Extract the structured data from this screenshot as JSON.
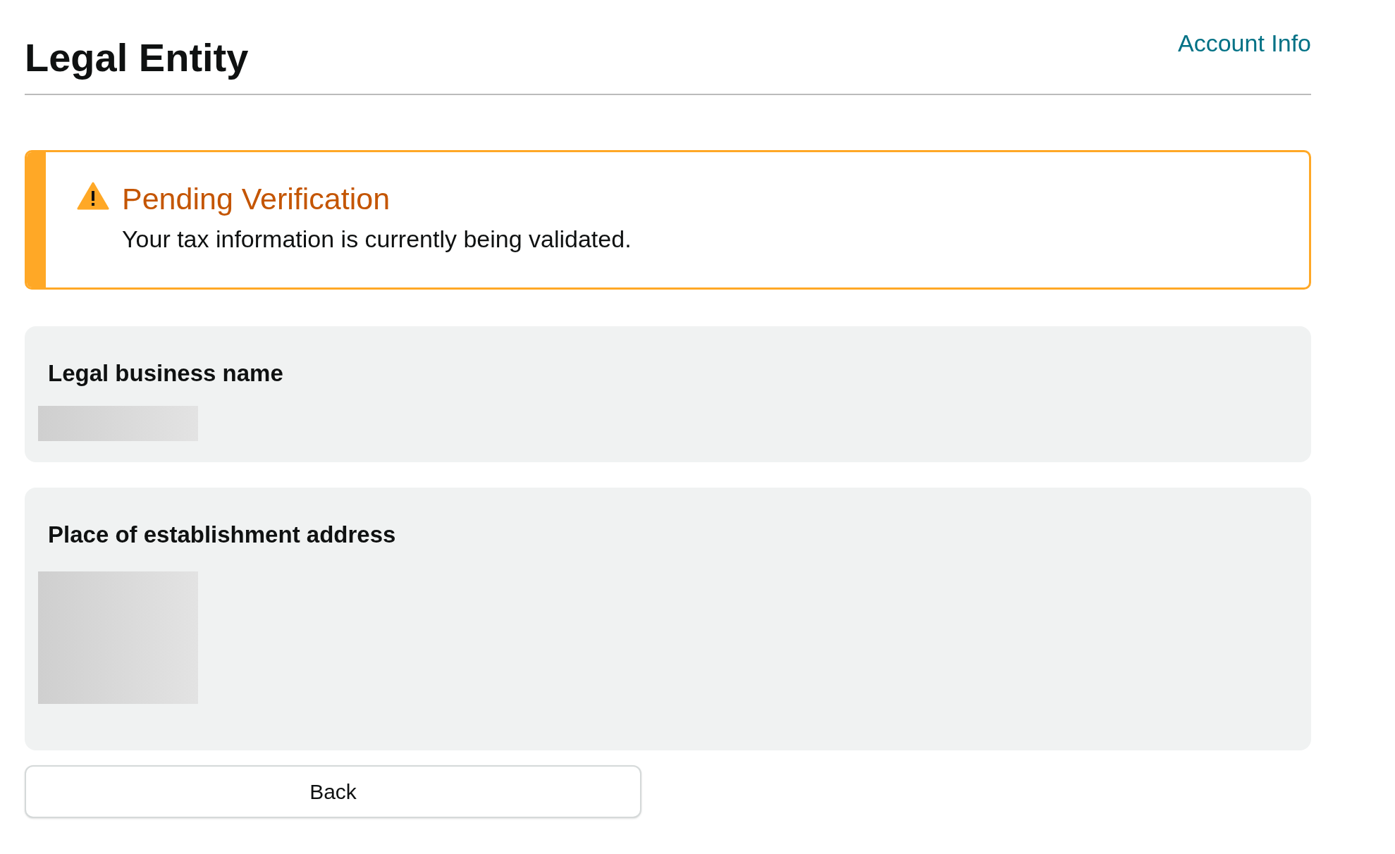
{
  "header": {
    "title": "Legal Entity",
    "link": "Account Info"
  },
  "alert": {
    "kind": "warning",
    "title": "Pending Verification",
    "message": "Your tax information is currently being validated."
  },
  "sections": [
    {
      "label": "Legal business name",
      "redacted": true
    },
    {
      "label": "Place of establishment address",
      "redacted": true
    }
  ],
  "buttons": [
    "Back"
  ]
}
